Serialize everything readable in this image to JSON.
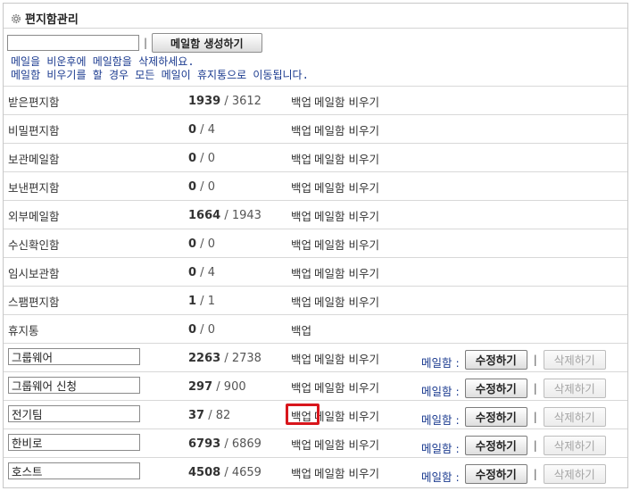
{
  "header": {
    "title": "편지함관리"
  },
  "create": {
    "input_value": "",
    "separator": "|",
    "button_label": "메일함 생성하기"
  },
  "notice": {
    "line1": "메일을 비운후에 메일함을 삭제하세요.",
    "line2": "메일함 비우기를 할 경우 모든 메일이 휴지통으로 이동됩니다."
  },
  "labels": {
    "backup": "백업",
    "empty": "메일함 비우기",
    "mailbox": "메일함 :",
    "edit": "수정하기",
    "delete": "삭제하기",
    "slash": " / ",
    "sep": "|"
  },
  "system_folders": [
    {
      "name": "받은편지함",
      "unread": "1939",
      "total": "3612",
      "can_empty": true
    },
    {
      "name": "비밀편지함",
      "unread": "0",
      "total": "4",
      "can_empty": true
    },
    {
      "name": "보관메일함",
      "unread": "0",
      "total": "0",
      "can_empty": true
    },
    {
      "name": "보낸편지함",
      "unread": "0",
      "total": "0",
      "can_empty": true
    },
    {
      "name": "외부메일함",
      "unread": "1664",
      "total": "1943",
      "can_empty": true
    },
    {
      "name": "수신확인함",
      "unread": "0",
      "total": "0",
      "can_empty": true
    },
    {
      "name": "임시보관함",
      "unread": "0",
      "total": "4",
      "can_empty": true
    },
    {
      "name": "스팸편지함",
      "unread": "1",
      "total": "1",
      "can_empty": true
    },
    {
      "name": "휴지통",
      "unread": "0",
      "total": "0",
      "can_empty": false
    }
  ],
  "user_folders": [
    {
      "name": "그룹웨어",
      "unread": "2263",
      "total": "2738",
      "highlight_backup": false
    },
    {
      "name": "그룹웨어 신청",
      "unread": "297",
      "total": "900",
      "highlight_backup": false
    },
    {
      "name": "전기팀",
      "unread": "37",
      "total": "82",
      "highlight_backup": true
    },
    {
      "name": "한비로",
      "unread": "6793",
      "total": "6869",
      "highlight_backup": false
    },
    {
      "name": "호스트",
      "unread": "4508",
      "total": "4659",
      "highlight_backup": false
    }
  ],
  "colors": {
    "accent_text": "#1a3a8f",
    "highlight": "#d8161c"
  },
  "icons": {
    "header": "gear-icon"
  }
}
